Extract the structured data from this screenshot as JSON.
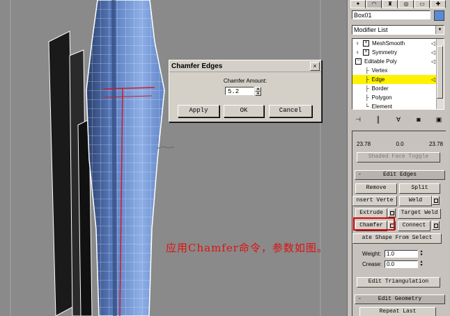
{
  "dialog": {
    "title": "Chamfer Edges",
    "close": "×",
    "amount_label": "Chamfer Amount:",
    "amount_value": "5.2",
    "apply": "Apply",
    "ok": "OK",
    "cancel": "Cancel"
  },
  "annotation": "应用Chamfer命令，参数如图。",
  "panel": {
    "object_name": "Box01",
    "object_color": "#5a8ad6",
    "modifier_list": "Modifier List",
    "stack": [
      {
        "label": "MeshSmooth"
      },
      {
        "label": "Symmetry"
      },
      {
        "label": "Editable Poly"
      },
      {
        "label": "Vertex"
      },
      {
        "label": "Edge"
      },
      {
        "label": "Border"
      },
      {
        "label": "Polygon"
      },
      {
        "label": "Element"
      }
    ],
    "numbers": [
      "23.78",
      "0.0",
      "23.78"
    ],
    "shaded_face_toggle": "Shaded Face Toggle",
    "edit_edges_title": "Edit Edges",
    "edit_edges_sign": "-",
    "remove": "Remove",
    "split": "Split",
    "insert_vertex": "nsert Verte",
    "weld": "Weld",
    "extrude": "Extrude",
    "target_weld": "Target Weld",
    "chamfer": "Chamfer",
    "connect": "Connect",
    "create_shape": "ate Shape From Select",
    "weight_label": "Weight:",
    "weight_value": "1.0",
    "crease_label": "Crease:",
    "crease_value": "0.0",
    "edit_triangulation": "Edit Triangulation",
    "edit_geometry_title": "Edit Geometry",
    "edit_geometry_sign": "-",
    "repeat_last": "Repeat Last"
  },
  "colors": {
    "highlight": "#fff200",
    "annotation": "#e01010",
    "mesh_blue": "#6f8fc8"
  }
}
